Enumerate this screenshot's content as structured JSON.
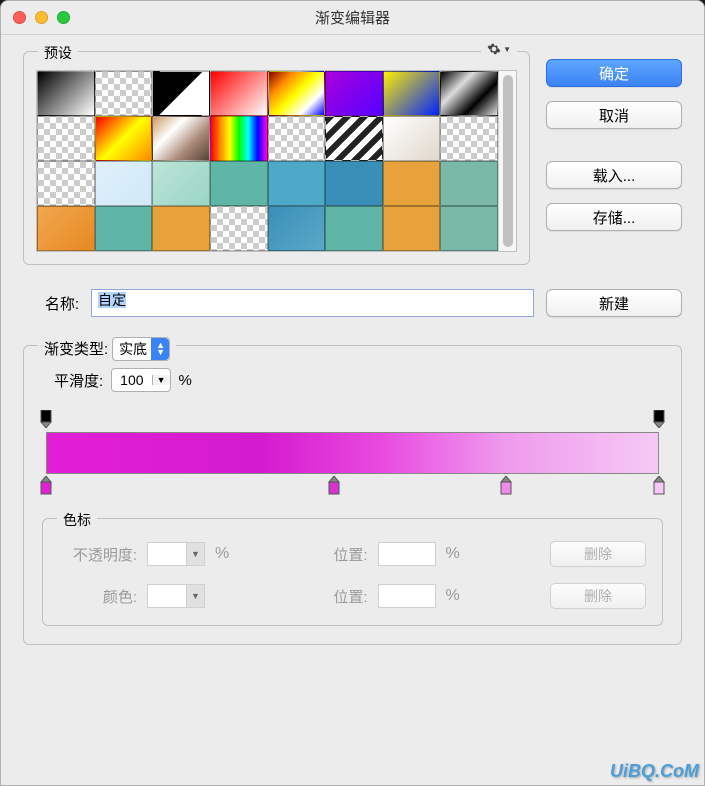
{
  "window": {
    "title": "渐变编辑器"
  },
  "presets": {
    "label": "预设"
  },
  "buttons": {
    "ok": "确定",
    "cancel": "取消",
    "load": "载入...",
    "save": "存储...",
    "new": "新建",
    "delete": "删除"
  },
  "name": {
    "label": "名称:",
    "value": "自定"
  },
  "gradientType": {
    "label": "渐变类型:",
    "value": "实底"
  },
  "smoothness": {
    "label": "平滑度:",
    "value": "100",
    "unit": "%"
  },
  "stops": {
    "label": "色标",
    "opacity": {
      "label": "不透明度:",
      "unit": "%"
    },
    "color": {
      "label": "颜色:"
    },
    "position": {
      "label": "位置:",
      "unit": "%"
    }
  },
  "opacityStops": [
    {
      "position": 0,
      "color": "#000"
    },
    {
      "position": 100,
      "color": "#000"
    }
  ],
  "colorStops": [
    {
      "position": 0,
      "color": "#e21ed6"
    },
    {
      "position": 47,
      "color": "#d633d0"
    },
    {
      "position": 75,
      "color": "#ec8be8"
    },
    {
      "position": 100,
      "color": "#f5c9f4"
    }
  ],
  "presetSwatches": [
    "linear-gradient(135deg,#000,#555,#aaa,#fff)",
    "checker",
    "linear-gradient(135deg,#000 50%,#fff 50%)",
    "linear-gradient(135deg,#f00,#fff)",
    "linear-gradient(135deg,#800,#f80,#ff0,#fff,#00f)",
    "linear-gradient(135deg,#a0d,#50f)",
    "linear-gradient(135deg,#fe0,#02f)",
    "linear-gradient(135deg,#000,#ddd,#000,#ddd)",
    "checker",
    "linear-gradient(135deg,#f00,#ff0,#f80)",
    "linear-gradient(135deg,#c96,#fff,#a87,#543)",
    "linear-gradient(90deg,#f00,#f80,#ff0,#0f0,#0ff,#00f,#f0f)",
    "checker",
    "repeating-linear-gradient(135deg,#222 0 6px,#fff 6px 12px)",
    "linear-gradient(135deg,#fff,#e0d8cc)",
    "checker",
    "checker",
    "linear-gradient(135deg,#e0f0fb,#d0e8f8)",
    "linear-gradient(135deg,#bde4d8,#9ad5c4)",
    "#5fb5a6",
    "#4ea8c8",
    "#3a8fb8",
    "#e8a23c",
    "#7ab8a8",
    "linear-gradient(135deg,#f0a850,#e88820)",
    "#5fb5a6",
    "#e8a23c",
    "checker",
    "linear-gradient(135deg,#3a8fb8,#5aa8c8)",
    "#5fb5a6",
    "#e8a23c",
    "#7ab8a8"
  ],
  "watermark": "UiBQ.CoM"
}
